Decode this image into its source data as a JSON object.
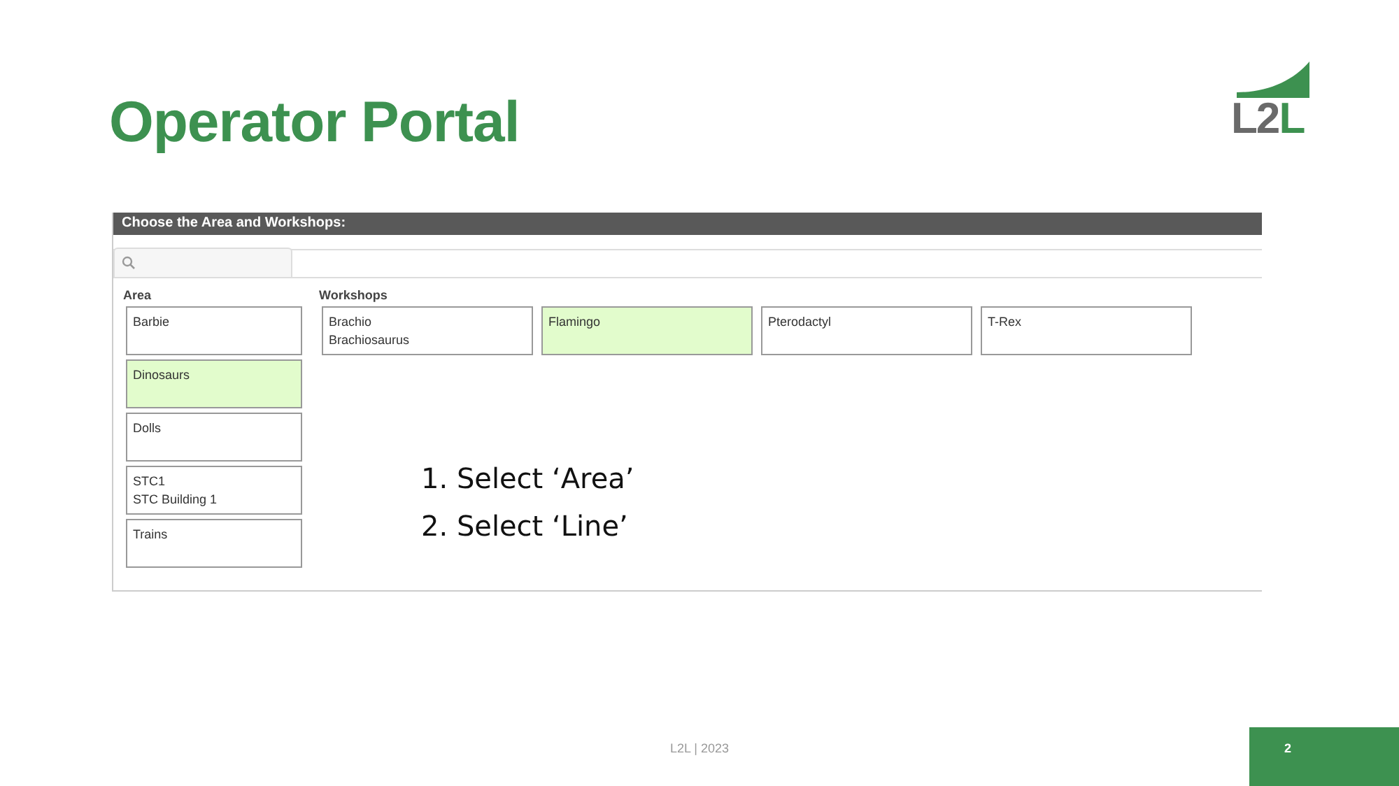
{
  "slide": {
    "title": "Operator Portal",
    "logo": "L2L",
    "footer": "L2L | 2023",
    "page_number": "2"
  },
  "portal": {
    "header": "Choose the Area and Workshops:",
    "area": {
      "label": "Area",
      "items": [
        {
          "lines": [
            "Barbie"
          ],
          "selected": false
        },
        {
          "lines": [
            "Dinosaurs"
          ],
          "selected": true
        },
        {
          "lines": [
            "Dolls"
          ],
          "selected": false
        },
        {
          "lines": [
            "STC1",
            "STC Building 1"
          ],
          "selected": false
        },
        {
          "lines": [
            "Trains"
          ],
          "selected": false
        }
      ]
    },
    "workshops": {
      "label": "Workshops",
      "items": [
        {
          "lines": [
            "Brachio",
            "Brachiosaurus"
          ],
          "selected": false
        },
        {
          "lines": [
            "Flamingo"
          ],
          "selected": true
        },
        {
          "lines": [
            "Pterodactyl"
          ],
          "selected": false
        },
        {
          "lines": [
            "T-Rex"
          ],
          "selected": false
        }
      ]
    }
  },
  "instructions": [
    "1. Select ‘Area’",
    "2. Select ‘Line’"
  ]
}
